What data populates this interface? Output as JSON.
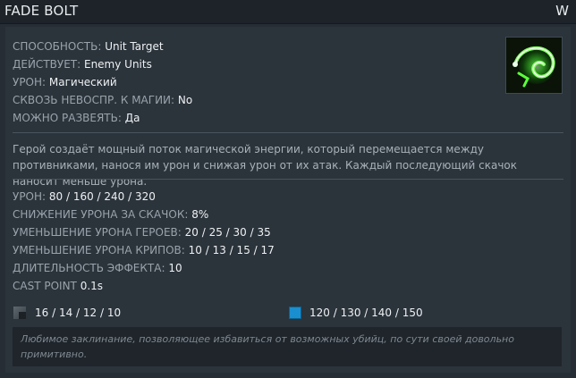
{
  "header": {
    "title": "FADE BOLT",
    "hotkey": "W"
  },
  "icon": {
    "name": "fade-bolt-ability-icon",
    "glow_color": "#4fff3a"
  },
  "attributes": [
    {
      "label": "СПОСОБНОСТЬ:",
      "value": "Unit Target"
    },
    {
      "label": "ДЕЙСТВУЕТ:",
      "value": "Enemy Units"
    },
    {
      "label": "УРОН:",
      "value": "Магический"
    },
    {
      "label": "СКВОЗЬ НЕВОСПР. К МАГИИ:",
      "value": "No"
    },
    {
      "label": "МОЖНО РАЗВЕЯТЬ:",
      "value": "Да"
    }
  ],
  "description": "Герой создаёт мощный поток магической энергии, который перемещается между противниками, нанося им урон и снижая урон от их атак. Каждый последующий скачок наносит меньше урона.",
  "stats": [
    {
      "label": "УРОН:",
      "value": "80 / 160 / 240 / 320"
    },
    {
      "label": "СНИЖЕНИЕ УРОНА ЗА СКАЧОК:",
      "value": "8%"
    },
    {
      "label": "УМЕНЬШЕНИЕ УРОНА ГЕРОЕВ:",
      "value": "20 / 25 / 30 / 35"
    },
    {
      "label": "УМЕНЬШЕНИЕ УРОНА КРИПОВ:",
      "value": "10 / 13 / 15 / 17"
    },
    {
      "label": "ДЛИТЕЛЬНОСТЬ ЭФФЕКТА:",
      "value": "10"
    },
    {
      "label": "CAST POINT",
      "value": "0.1s"
    }
  ],
  "cooldown": {
    "icon": "cooldown-icon",
    "value": "16 / 14 / 12 / 10"
  },
  "mana": {
    "icon": "mana-icon",
    "value": "120 / 130 / 140 / 150",
    "color": "#1a8fcf"
  },
  "lore": "Любимое заклинание, позволяющее избавиться от возможных убийц, по сути своей довольно примитивно."
}
